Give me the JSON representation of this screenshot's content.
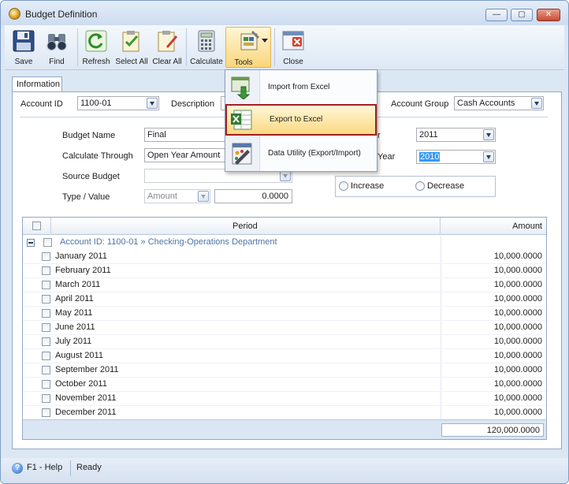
{
  "window": {
    "title": "Budget Definition",
    "controls": {
      "minimize": "—",
      "maximize": "▢",
      "close": "✕"
    }
  },
  "toolbar": {
    "buttons": [
      {
        "label": "Save",
        "icon": "floppy-disk-icon"
      },
      {
        "label": "Find",
        "icon": "binoculars-icon"
      },
      {
        "label": "Refresh",
        "icon": "refresh-icon"
      },
      {
        "label": "Select All",
        "icon": "select-all-icon"
      },
      {
        "label": "Clear All",
        "icon": "clear-all-icon"
      },
      {
        "label": "Calculate",
        "icon": "calculator-icon"
      },
      {
        "label": "Tools",
        "icon": "tools-icon"
      },
      {
        "label": "Close",
        "icon": "close-icon"
      }
    ]
  },
  "tools_menu": {
    "items": [
      {
        "label": "Import from Excel",
        "icon": "import-excel-icon"
      },
      {
        "label": "Export to Excel",
        "icon": "export-excel-icon",
        "highlighted": true
      },
      {
        "label": "Data Utility (Export/Import)",
        "icon": "data-utility-icon"
      }
    ]
  },
  "tabs": {
    "information": "Information"
  },
  "form": {
    "account_id_label": "Account ID",
    "account_id_value": "1100-01",
    "description_label": "Description",
    "account_group_label": "Account Group",
    "account_group_value": "Cash Accounts",
    "budget_name_label": "Budget Name",
    "budget_name_value": "Final",
    "calculate_through_label": "Calculate Through",
    "calculate_through_value": "Open Year Amount",
    "source_budget_label": "Source Budget",
    "source_budget_value": "",
    "type_value_label": "Type / Value",
    "type_value": "Amount",
    "value_amount": "0.0000",
    "fiscal_year_label_visible": "r",
    "fiscal_year_value": "2011",
    "prior_year_label_visible": "Year",
    "prior_year_value": "2010",
    "increase_label": "Increase",
    "decrease_label": "Decrease"
  },
  "grid": {
    "columns": [
      "Period",
      "Amount"
    ],
    "group_label": "Account ID: 1100-01 » Checking-Operations Department",
    "rows": [
      {
        "period": "January 2011",
        "amount": "10,000.0000"
      },
      {
        "period": "February 2011",
        "amount": "10,000.0000"
      },
      {
        "period": "March 2011",
        "amount": "10,000.0000"
      },
      {
        "period": "April 2011",
        "amount": "10,000.0000"
      },
      {
        "period": "May 2011",
        "amount": "10,000.0000"
      },
      {
        "period": "June 2011",
        "amount": "10,000.0000"
      },
      {
        "period": "July 2011",
        "amount": "10,000.0000"
      },
      {
        "period": "August 2011",
        "amount": "10,000.0000"
      },
      {
        "period": "September 2011",
        "amount": "10,000.0000"
      },
      {
        "period": "October 2011",
        "amount": "10,000.0000"
      },
      {
        "period": "November 2011",
        "amount": "10,000.0000"
      },
      {
        "period": "December 2011",
        "amount": "10,000.0000"
      }
    ],
    "total": "120,000.0000"
  },
  "statusbar": {
    "help": "F1 - Help",
    "status": "Ready"
  },
  "colors": {
    "highlight": "#fad982",
    "highlight_border": "#a51f1f",
    "group_text": "#4d75a6",
    "selection": "#3399ff"
  }
}
